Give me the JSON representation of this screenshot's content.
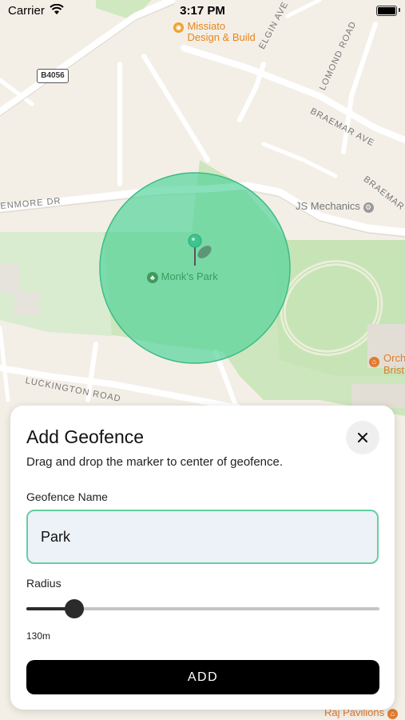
{
  "status_bar": {
    "carrier": "Carrier",
    "time": "3:17 PM"
  },
  "map": {
    "road_badge": "B4056",
    "streets": {
      "elgin": "ELGIN AVE",
      "lomond": "LOMOND ROAD",
      "braemar_ave": "BRAEMAR AVE",
      "braemar_cr": "BRAEMAR CR",
      "glenmore": "ENMORE DR",
      "luckington": "LUCKINGTON ROAD"
    },
    "pois": {
      "missiato_line1": "Missiato",
      "missiato_line2": "Design & Build",
      "js_mechanics": "JS Mechanics",
      "monks_park": "Monk's Park",
      "orch_line1": "Orch",
      "orch_line2": "Brist",
      "raj": "Raj Pavilions"
    },
    "geofence_color": "#4fd39a"
  },
  "sheet": {
    "title": "Add Geofence",
    "subtitle": "Drag and drop the marker to center of geofence.",
    "name_label": "Geofence Name",
    "name_value": "Park",
    "radius_label": "Radius",
    "radius_value": "130m",
    "radius_fraction": 0.135,
    "add_label": "ADD"
  }
}
